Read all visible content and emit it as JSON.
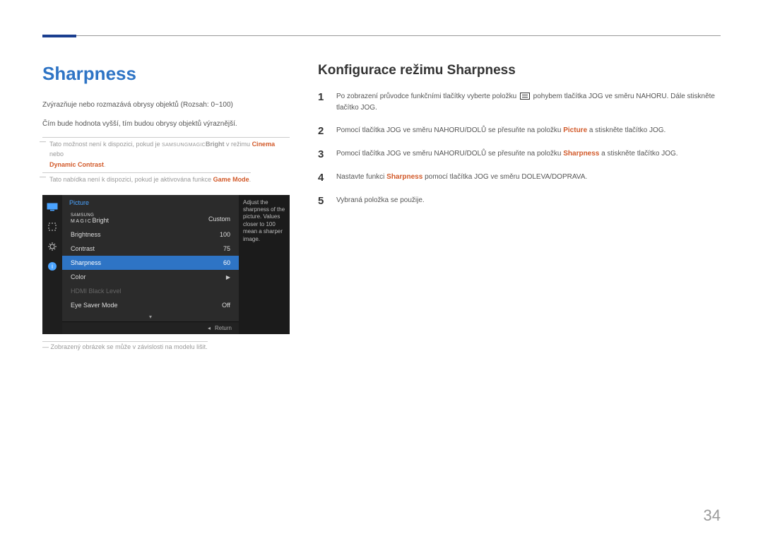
{
  "left": {
    "title": "Sharpness",
    "desc1": "Zvýrazňuje nebo rozmazává obrysy objektů (Rozsah: 0~100)",
    "desc2": "Čím bude hodnota vyšší, tím budou obrysy objektů výraznější.",
    "note1_pre": "Tato možnost není k dispozici, pokud je ",
    "note1_magic_prefix": "SAMSUNG",
    "note1_magic": "MAGIC",
    "note1_bright": "Bright",
    "note1_mid": " v režimu ",
    "note1_cinema": "Cinema",
    "note1_or": " nebo ",
    "note1_dynamic": "Dynamic Contrast",
    "note1_end": ".",
    "note2_pre": "Tato nabídka není k dispozici, pokud je aktivována funkce ",
    "note2_game": "Game Mode",
    "note2_end": ".",
    "caption": "Zobrazený obrázek se může v závislosti na modelu lišit."
  },
  "osd": {
    "header": "Picture",
    "rows": [
      {
        "label_prefix": "SAMSUNG",
        "label_magic": "MAGIC",
        "label": "Bright",
        "value": "Custom"
      },
      {
        "label": "Brightness",
        "value": "100"
      },
      {
        "label": "Contrast",
        "value": "75"
      },
      {
        "label": "Sharpness",
        "value": "60",
        "selected": true
      },
      {
        "label": "Color",
        "value": "▶"
      },
      {
        "label": "HDMI Black Level",
        "value": "",
        "disabled": true
      },
      {
        "label": "Eye Saver Mode",
        "value": "Off"
      }
    ],
    "info": "Adjust the sharpness of the picture. Values closer to 100 mean a sharper image.",
    "return": "Return"
  },
  "right": {
    "title": "Konfigurace režimu Sharpness",
    "steps": [
      {
        "n": "1",
        "pre": "Po zobrazení průvodce funkčními tlačítky vyberte položku ",
        "post": " pohybem tlačítka JOG ve směru NAHORU. Dále stiskněte tlačítko JOG."
      },
      {
        "n": "2",
        "pre": "Pomocí tlačítka JOG ve směru NAHORU/DOLŮ se přesuňte na položku ",
        "kw": "Picture",
        "post": " a stiskněte tlačítko JOG."
      },
      {
        "n": "3",
        "pre": "Pomocí tlačítka JOG ve směru NAHORU/DOLŮ se přesuňte na položku ",
        "kw": "Sharpness",
        "post": " a stiskněte tlačítko JOG."
      },
      {
        "n": "4",
        "pre": "Nastavte funkci ",
        "kw": "Sharpness",
        "post": " pomocí tlačítka JOG ve směru DOLEVA/DOPRAVA."
      },
      {
        "n": "5",
        "pre": "Vybraná položka se použije.",
        "kw": "",
        "post": ""
      }
    ]
  },
  "page_number": "34"
}
